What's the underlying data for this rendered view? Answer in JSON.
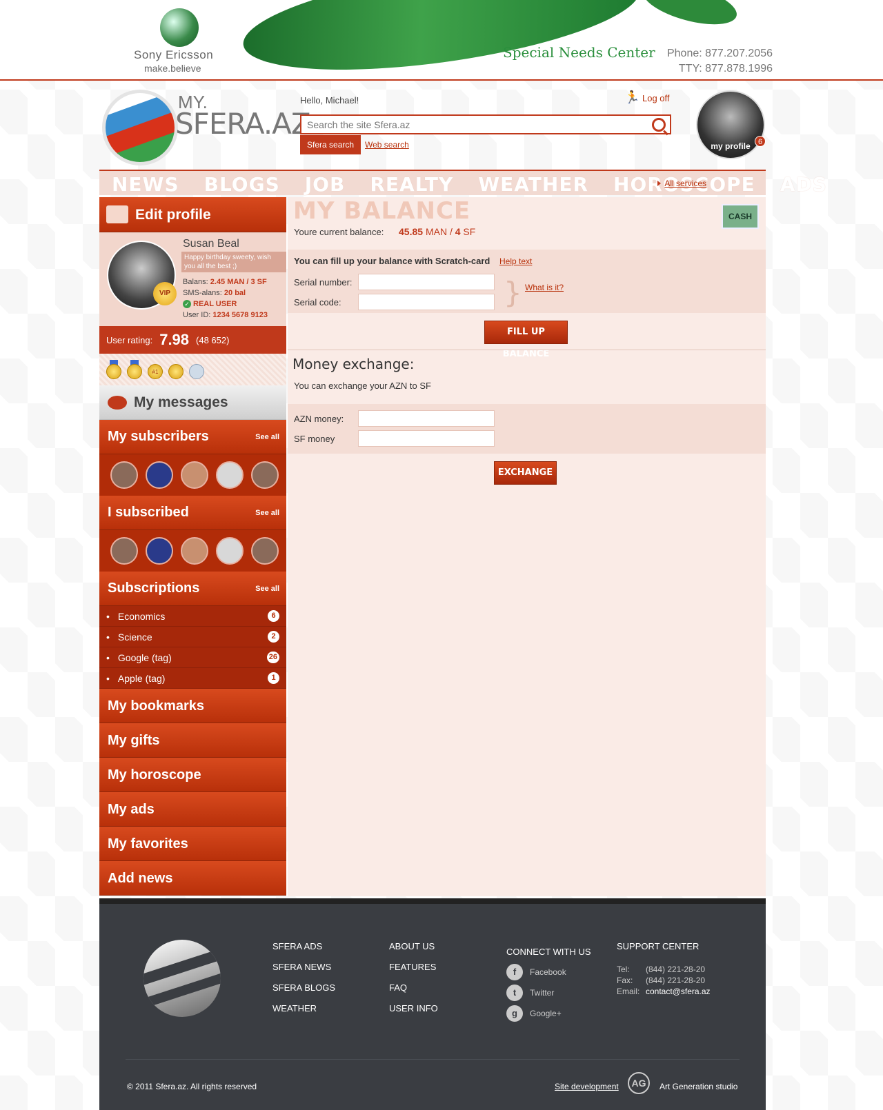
{
  "banner": {
    "brand": "Sony Ericsson",
    "tagline": "make.believe",
    "center": "Special Needs Center",
    "phone": "Phone: 877.207.2056",
    "tty": "TTY: 877.878.1996"
  },
  "header": {
    "logo_top": "MY.",
    "logo_main": "SFERA.AZ",
    "greeting": "Hello, Michael!",
    "logoff": "Log off",
    "search_placeholder": "Search the site Sfera.az",
    "tab_sfera": "Sfera search",
    "tab_web": "Web search",
    "profile_label": "my profile",
    "profile_badge": "6"
  },
  "nav": {
    "items": [
      "NEWS",
      "BLOGS",
      "JOB",
      "REALTY",
      "WEATHER",
      "HOROSCOPE",
      "ADS"
    ],
    "all_services": "All services"
  },
  "sidebar": {
    "edit_profile": "Edit profile",
    "user_name": "Susan Beal",
    "status_msg": "Happy birthday sweety, wish you all the best ;)",
    "balans_label": "Balans:",
    "balans_value": "2.45 MAN / 3 SF",
    "sms_label": "SMS-alans:",
    "sms_value": "20 bal",
    "real_user": "REAL USER",
    "user_id_label": "User ID:",
    "user_id_value": "1234 5678 9123",
    "vip": "VIP",
    "rating_label": "User rating:",
    "rating_value": "7.98",
    "rating_count": "(48 652)",
    "medal_label": "#1",
    "messages": "My messages",
    "subscribers": "My subscribers",
    "i_subscribed": "I subscribed",
    "subscriptions": "Subscriptions",
    "see_all": "See all",
    "subscription_items": [
      {
        "label": "Economics",
        "count": "6"
      },
      {
        "label": "Science",
        "count": "2"
      },
      {
        "label": "Google (tag)",
        "count": "26"
      },
      {
        "label": "Apple (tag)",
        "count": "1"
      }
    ],
    "bookmarks": "My bookmarks",
    "gifts": "My gifts",
    "horoscope": "My horoscope",
    "ads": "My ads",
    "favorites": "My favorites",
    "add_news": "Add news"
  },
  "main": {
    "title": "MY BALANCE",
    "cash_label": "CASH",
    "balance_label": "Youre current balance:",
    "balance_man": "45.85",
    "balance_man_unit": "MAN",
    "balance_sf": "4",
    "balance_sf_unit": "SF",
    "scratch_title": "You can fill up your balance with Scratch-card",
    "help_text": "Help text",
    "serial_number": "Serial number:",
    "serial_code": "Serial code:",
    "what_is_it": "What is it?",
    "fill_button": "FILL UP BALANCE",
    "exchange_title": "Money exchange:",
    "exchange_sub": "You can exchange your AZN to SF",
    "azn_label": "AZN money:",
    "sf_label": "SF money",
    "exchange_button": "EXCHANGE"
  },
  "footer": {
    "col1": [
      "SFERA ADS",
      "SFERA NEWS",
      "SFERA BLOGS",
      "WEATHER"
    ],
    "col2": [
      "ABOUT US",
      "FEATURES",
      "FAQ",
      "USER INFO"
    ],
    "connect_title": "CONNECT WITH US",
    "social": [
      "Facebook",
      "Twitter",
      "Google+"
    ],
    "support_title": "SUPPORT CENTER",
    "tel_label": "Tel:",
    "tel": "(844) 221-28-20",
    "fax_label": "Fax:",
    "fax": "(844) 221-28-20",
    "email_label": "Email:",
    "email": "contact@sfera.az",
    "copyright": "© 2011 Sfera.az. All rights reserved",
    "site_dev": "Site development",
    "studio": "Art Generation studio",
    "studio_logo": "AG"
  }
}
